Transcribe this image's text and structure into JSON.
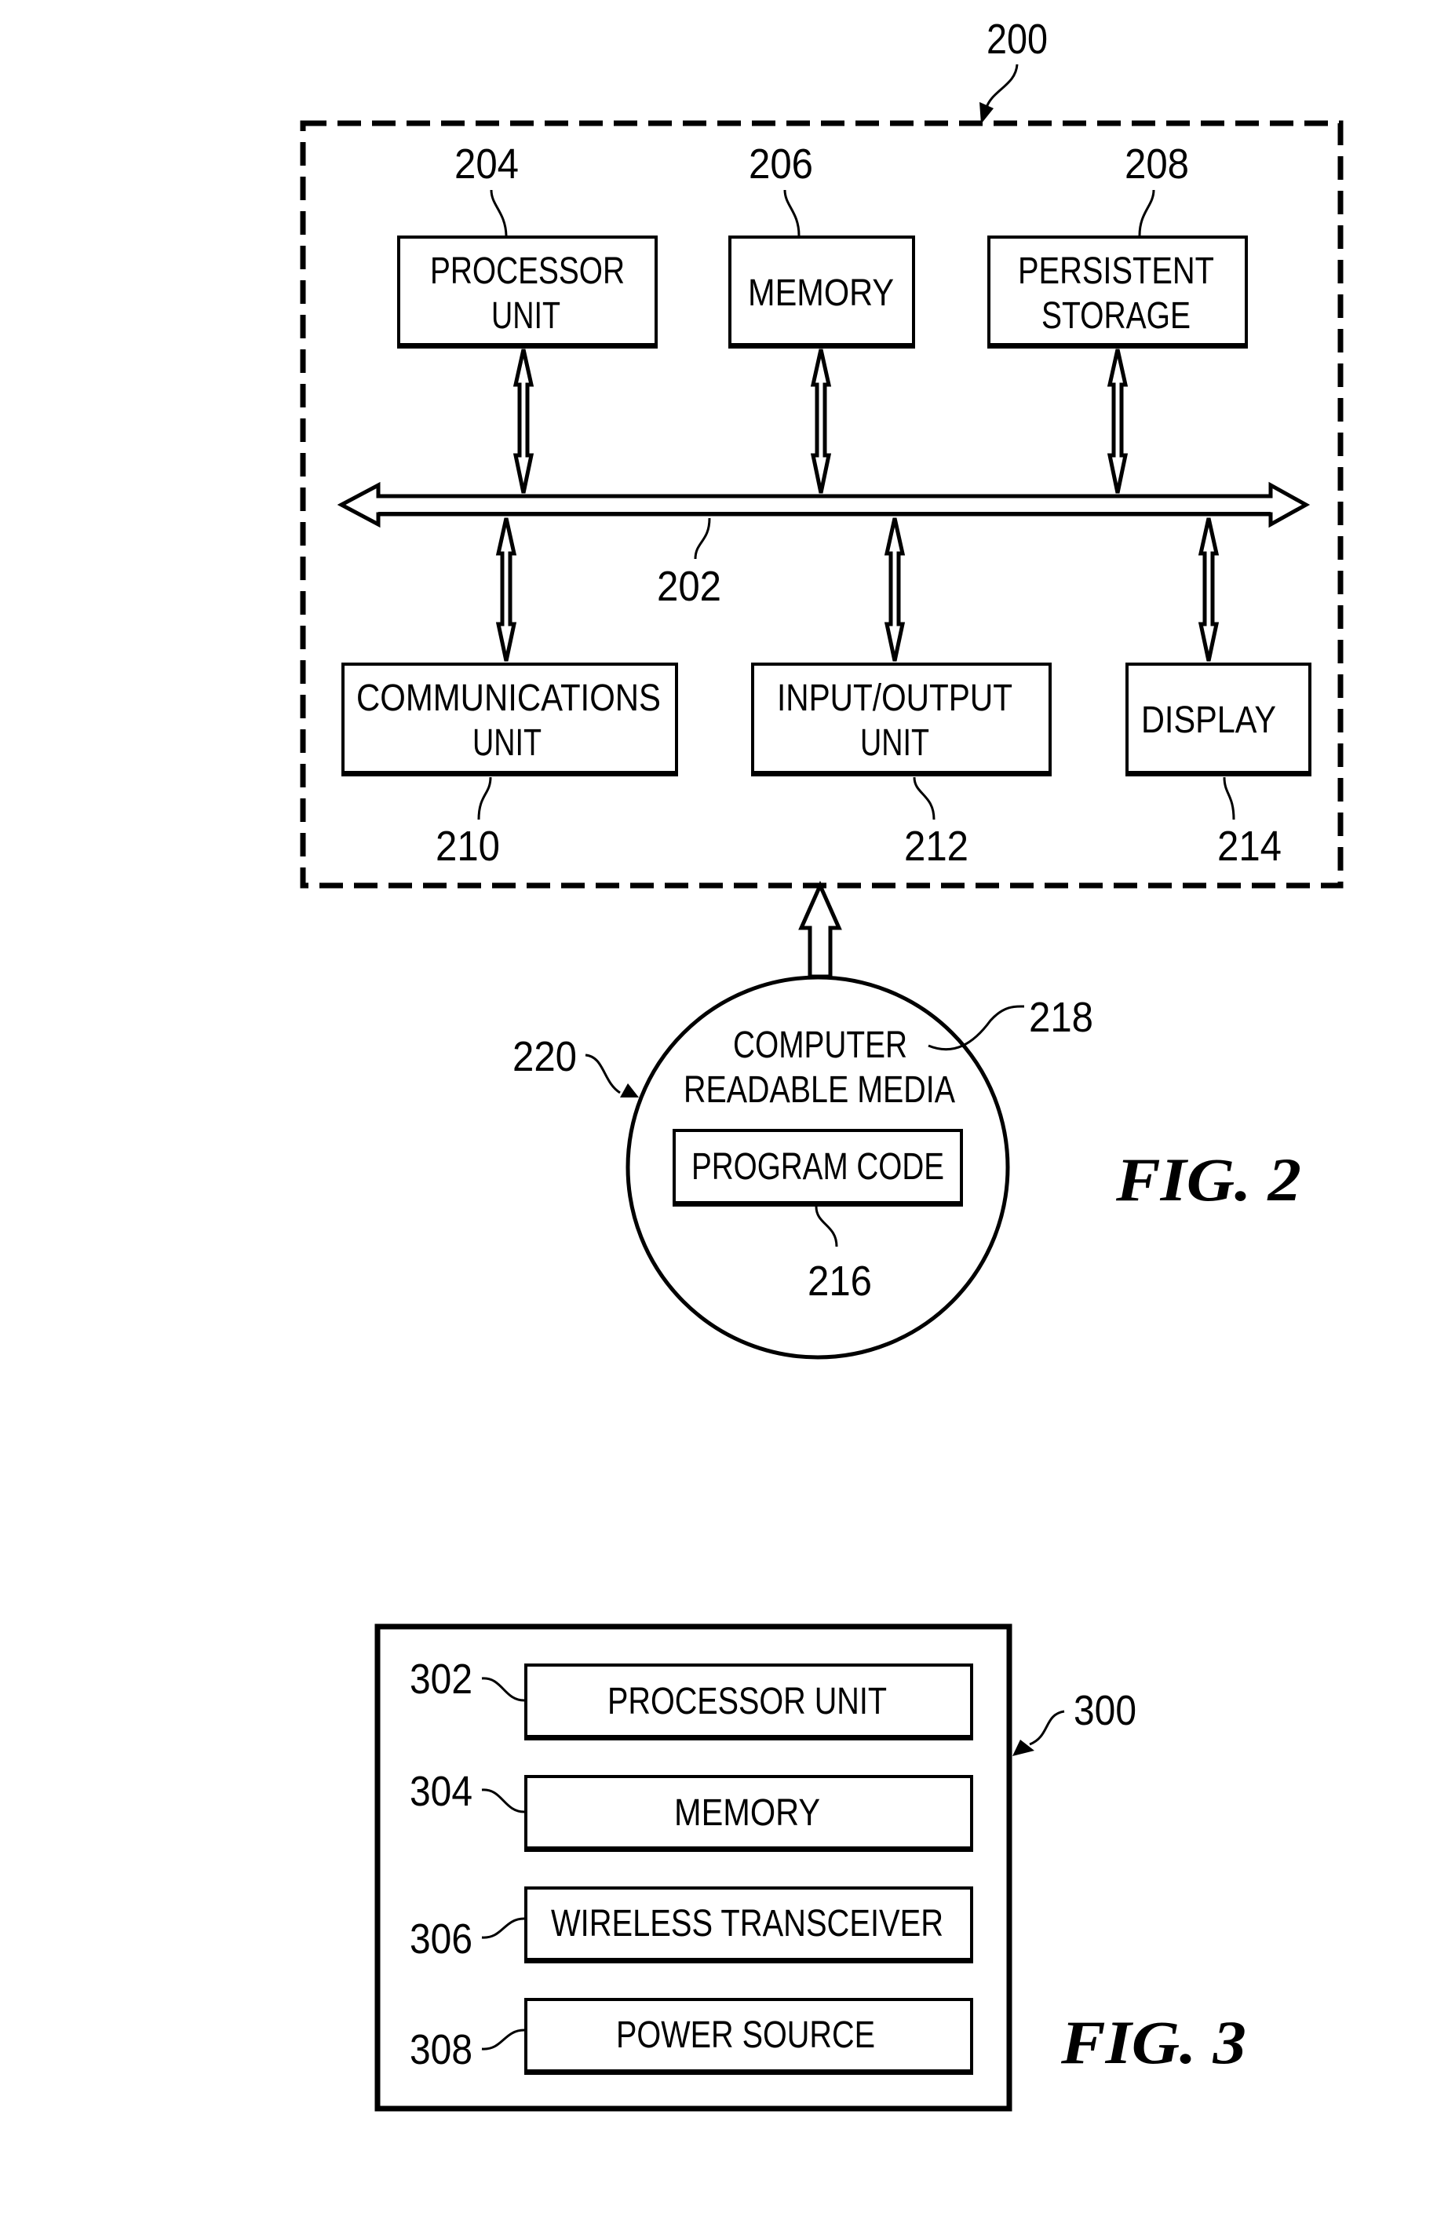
{
  "figure2": {
    "caption": "FIG. 2",
    "system_ref": "200",
    "bus_ref": "202",
    "components": [
      {
        "ref": "204",
        "lines": [
          "PROCESSOR",
          "UNIT"
        ]
      },
      {
        "ref": "206",
        "lines": [
          "MEMORY"
        ]
      },
      {
        "ref": "208",
        "lines": [
          "PERSISTENT",
          "STORAGE"
        ]
      },
      {
        "ref": "210",
        "lines": [
          "COMMUNICATIONS",
          "UNIT"
        ]
      },
      {
        "ref": "212",
        "lines": [
          "INPUT/OUTPUT",
          "UNIT"
        ]
      },
      {
        "ref": "214",
        "lines": [
          "DISPLAY"
        ]
      }
    ],
    "media": {
      "ref": "220",
      "media_ref": "218",
      "lines": [
        "COMPUTER",
        "READABLE MEDIA"
      ],
      "program_code": {
        "ref": "216",
        "label": "PROGRAM CODE"
      }
    }
  },
  "figure3": {
    "caption": "FIG. 3",
    "device_ref": "300",
    "components": [
      {
        "ref": "302",
        "label": "PROCESSOR UNIT"
      },
      {
        "ref": "304",
        "label": "MEMORY"
      },
      {
        "ref": "306",
        "label": "WIRELESS TRANSCEIVER"
      },
      {
        "ref": "308",
        "label": "POWER SOURCE"
      }
    ]
  }
}
